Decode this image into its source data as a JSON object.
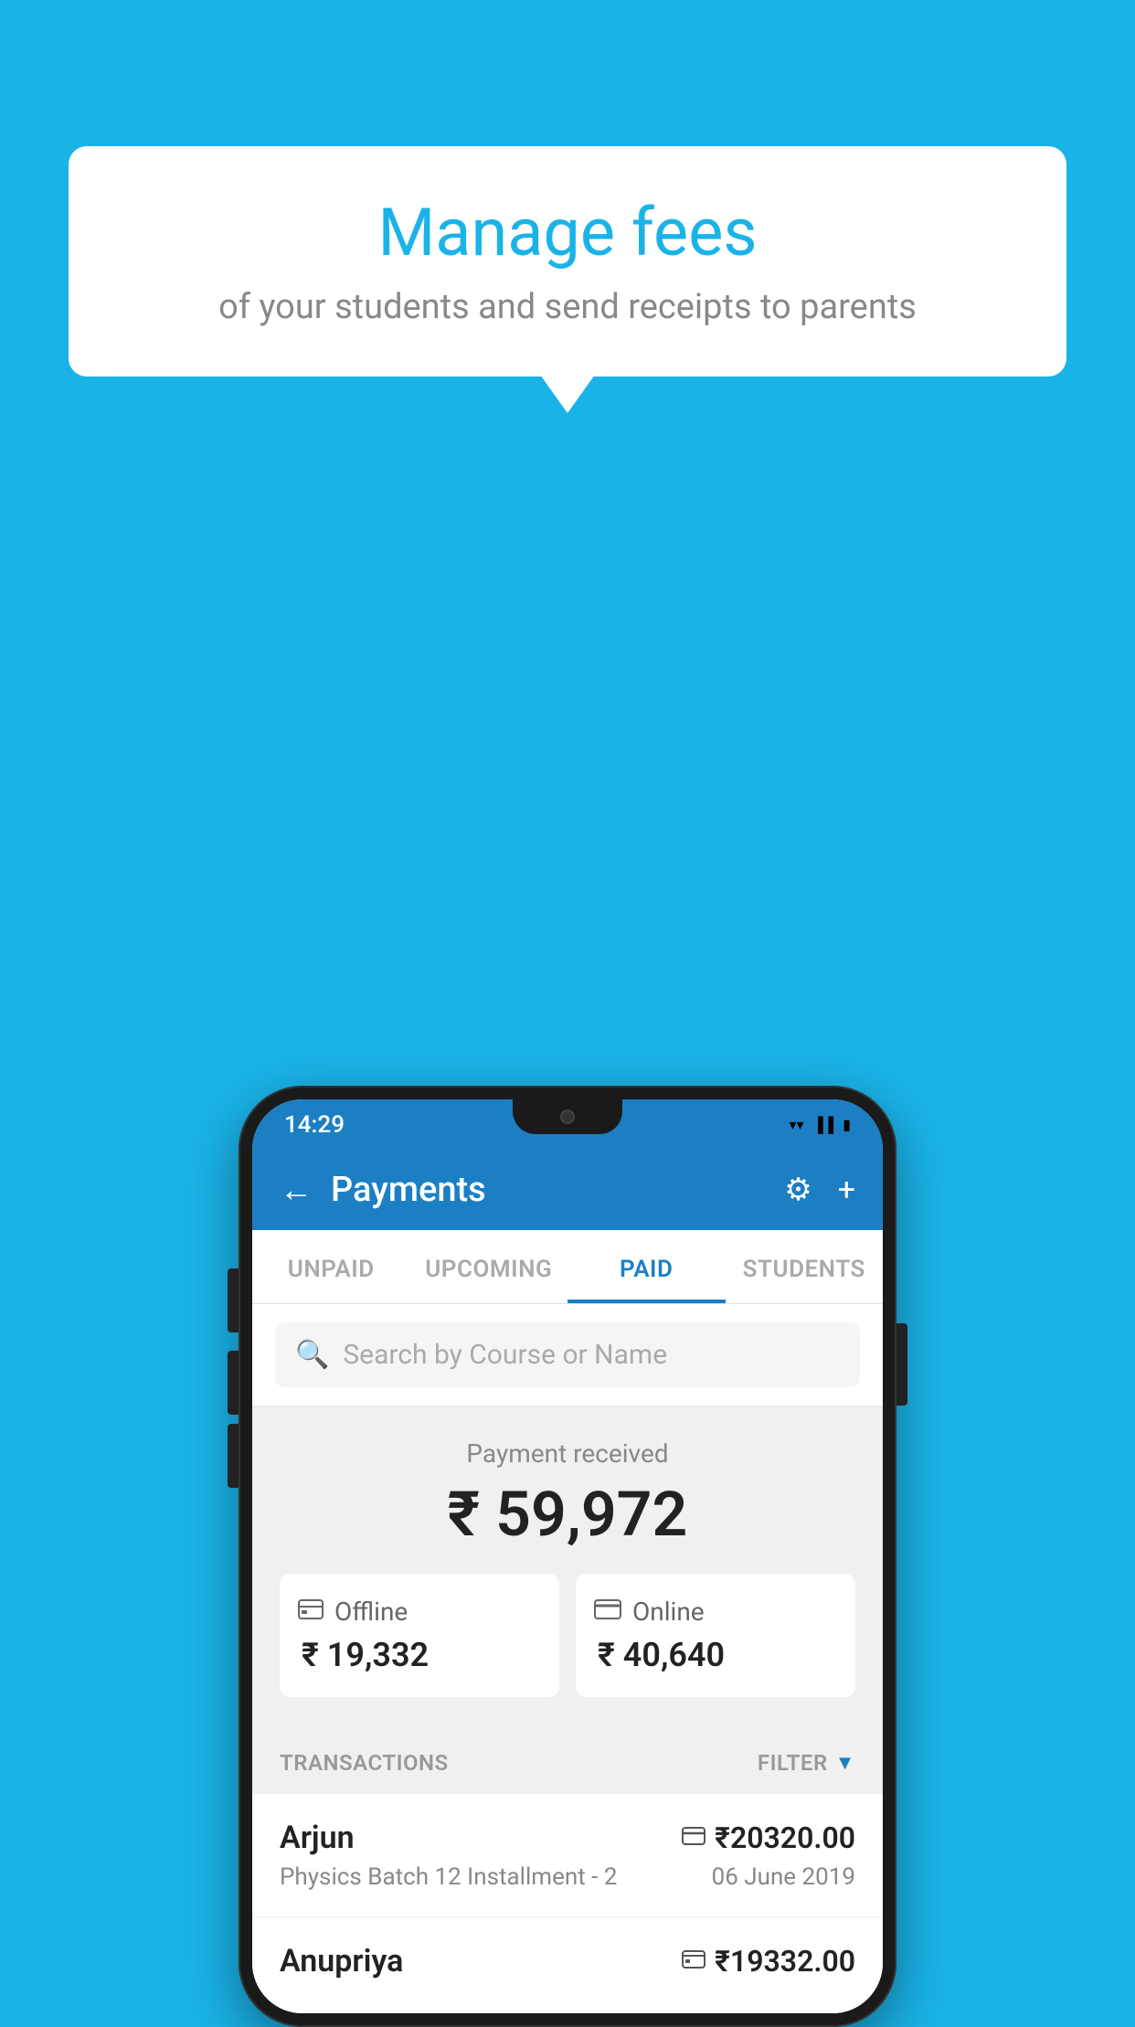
{
  "background_color": "#1ab3e8",
  "bubble": {
    "title": "Manage fees",
    "subtitle": "of your students and send receipts to parents"
  },
  "status_bar": {
    "time": "14:29",
    "wifi_icon": "▼",
    "signal_icon": "◄",
    "battery_icon": "▮"
  },
  "app_bar": {
    "title": "Payments",
    "back_icon": "←",
    "gear_icon": "⚙",
    "add_icon": "+"
  },
  "tabs": [
    {
      "label": "UNPAID",
      "active": false
    },
    {
      "label": "UPCOMING",
      "active": false
    },
    {
      "label": "PAID",
      "active": true
    },
    {
      "label": "STUDENTS",
      "active": false
    }
  ],
  "search": {
    "placeholder": "Search by Course or Name",
    "icon": "🔍"
  },
  "payment_summary": {
    "label": "Payment received",
    "amount": "₹ 59,972",
    "offline": {
      "label": "Offline",
      "amount": "₹ 19,332",
      "icon": "📄"
    },
    "online": {
      "label": "Online",
      "amount": "₹ 40,640",
      "icon": "💳"
    }
  },
  "transactions": {
    "label": "TRANSACTIONS",
    "filter_label": "FILTER",
    "filter_icon": "▼",
    "items": [
      {
        "name": "Arjun",
        "course": "Physics Batch 12 Installment - 2",
        "amount": "₹20320.00",
        "date": "06 June 2019",
        "payment_type": "online",
        "icon": "💳"
      },
      {
        "name": "Anupriya",
        "course": "",
        "amount": "₹19332.00",
        "date": "",
        "payment_type": "offline",
        "icon": "📄"
      }
    ]
  }
}
